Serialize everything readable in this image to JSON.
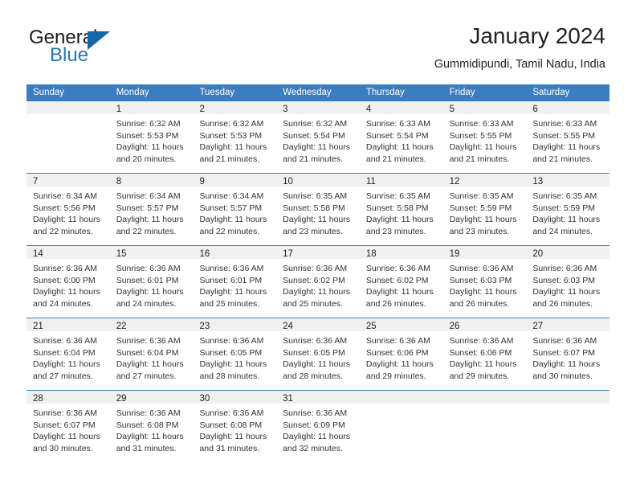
{
  "brand": {
    "name_line1": "General",
    "name_line2": "Blue",
    "triangle_color": "#1266ab",
    "blue_color": "#2376bc"
  },
  "header": {
    "title": "January 2024",
    "subtitle": "Gummidipundi, Tamil Nadu, India"
  },
  "theme": {
    "header_blue": "#3a7dc0",
    "daynum_band": "#f0f0f0",
    "text": "#222222"
  },
  "calendar": {
    "weekday_headers": [
      "Sunday",
      "Monday",
      "Tuesday",
      "Wednesday",
      "Thursday",
      "Friday",
      "Saturday"
    ],
    "weeks": [
      [
        {
          "day": "",
          "empty": true,
          "sunrise": "",
          "sunset": "",
          "daylight_l1": "",
          "daylight_l2": ""
        },
        {
          "day": "1",
          "empty": false,
          "sunrise": "Sunrise: 6:32 AM",
          "sunset": "Sunset: 5:53 PM",
          "daylight_l1": "Daylight: 11 hours",
          "daylight_l2": "and 20 minutes."
        },
        {
          "day": "2",
          "empty": false,
          "sunrise": "Sunrise: 6:32 AM",
          "sunset": "Sunset: 5:53 PM",
          "daylight_l1": "Daylight: 11 hours",
          "daylight_l2": "and 21 minutes."
        },
        {
          "day": "3",
          "empty": false,
          "sunrise": "Sunrise: 6:32 AM",
          "sunset": "Sunset: 5:54 PM",
          "daylight_l1": "Daylight: 11 hours",
          "daylight_l2": "and 21 minutes."
        },
        {
          "day": "4",
          "empty": false,
          "sunrise": "Sunrise: 6:33 AM",
          "sunset": "Sunset: 5:54 PM",
          "daylight_l1": "Daylight: 11 hours",
          "daylight_l2": "and 21 minutes."
        },
        {
          "day": "5",
          "empty": false,
          "sunrise": "Sunrise: 6:33 AM",
          "sunset": "Sunset: 5:55 PM",
          "daylight_l1": "Daylight: 11 hours",
          "daylight_l2": "and 21 minutes."
        },
        {
          "day": "6",
          "empty": false,
          "sunrise": "Sunrise: 6:33 AM",
          "sunset": "Sunset: 5:55 PM",
          "daylight_l1": "Daylight: 11 hours",
          "daylight_l2": "and 21 minutes."
        }
      ],
      [
        {
          "day": "7",
          "empty": false,
          "sunrise": "Sunrise: 6:34 AM",
          "sunset": "Sunset: 5:56 PM",
          "daylight_l1": "Daylight: 11 hours",
          "daylight_l2": "and 22 minutes."
        },
        {
          "day": "8",
          "empty": false,
          "sunrise": "Sunrise: 6:34 AM",
          "sunset": "Sunset: 5:57 PM",
          "daylight_l1": "Daylight: 11 hours",
          "daylight_l2": "and 22 minutes."
        },
        {
          "day": "9",
          "empty": false,
          "sunrise": "Sunrise: 6:34 AM",
          "sunset": "Sunset: 5:57 PM",
          "daylight_l1": "Daylight: 11 hours",
          "daylight_l2": "and 22 minutes."
        },
        {
          "day": "10",
          "empty": false,
          "sunrise": "Sunrise: 6:35 AM",
          "sunset": "Sunset: 5:58 PM",
          "daylight_l1": "Daylight: 11 hours",
          "daylight_l2": "and 23 minutes."
        },
        {
          "day": "11",
          "empty": false,
          "sunrise": "Sunrise: 6:35 AM",
          "sunset": "Sunset: 5:58 PM",
          "daylight_l1": "Daylight: 11 hours",
          "daylight_l2": "and 23 minutes."
        },
        {
          "day": "12",
          "empty": false,
          "sunrise": "Sunrise: 6:35 AM",
          "sunset": "Sunset: 5:59 PM",
          "daylight_l1": "Daylight: 11 hours",
          "daylight_l2": "and 23 minutes."
        },
        {
          "day": "13",
          "empty": false,
          "sunrise": "Sunrise: 6:35 AM",
          "sunset": "Sunset: 5:59 PM",
          "daylight_l1": "Daylight: 11 hours",
          "daylight_l2": "and 24 minutes."
        }
      ],
      [
        {
          "day": "14",
          "empty": false,
          "sunrise": "Sunrise: 6:36 AM",
          "sunset": "Sunset: 6:00 PM",
          "daylight_l1": "Daylight: 11 hours",
          "daylight_l2": "and 24 minutes."
        },
        {
          "day": "15",
          "empty": false,
          "sunrise": "Sunrise: 6:36 AM",
          "sunset": "Sunset: 6:01 PM",
          "daylight_l1": "Daylight: 11 hours",
          "daylight_l2": "and 24 minutes."
        },
        {
          "day": "16",
          "empty": false,
          "sunrise": "Sunrise: 6:36 AM",
          "sunset": "Sunset: 6:01 PM",
          "daylight_l1": "Daylight: 11 hours",
          "daylight_l2": "and 25 minutes."
        },
        {
          "day": "17",
          "empty": false,
          "sunrise": "Sunrise: 6:36 AM",
          "sunset": "Sunset: 6:02 PM",
          "daylight_l1": "Daylight: 11 hours",
          "daylight_l2": "and 25 minutes."
        },
        {
          "day": "18",
          "empty": false,
          "sunrise": "Sunrise: 6:36 AM",
          "sunset": "Sunset: 6:02 PM",
          "daylight_l1": "Daylight: 11 hours",
          "daylight_l2": "and 26 minutes."
        },
        {
          "day": "19",
          "empty": false,
          "sunrise": "Sunrise: 6:36 AM",
          "sunset": "Sunset: 6:03 PM",
          "daylight_l1": "Daylight: 11 hours",
          "daylight_l2": "and 26 minutes."
        },
        {
          "day": "20",
          "empty": false,
          "sunrise": "Sunrise: 6:36 AM",
          "sunset": "Sunset: 6:03 PM",
          "daylight_l1": "Daylight: 11 hours",
          "daylight_l2": "and 26 minutes."
        }
      ],
      [
        {
          "day": "21",
          "empty": false,
          "sunrise": "Sunrise: 6:36 AM",
          "sunset": "Sunset: 6:04 PM",
          "daylight_l1": "Daylight: 11 hours",
          "daylight_l2": "and 27 minutes."
        },
        {
          "day": "22",
          "empty": false,
          "sunrise": "Sunrise: 6:36 AM",
          "sunset": "Sunset: 6:04 PM",
          "daylight_l1": "Daylight: 11 hours",
          "daylight_l2": "and 27 minutes."
        },
        {
          "day": "23",
          "empty": false,
          "sunrise": "Sunrise: 6:36 AM",
          "sunset": "Sunset: 6:05 PM",
          "daylight_l1": "Daylight: 11 hours",
          "daylight_l2": "and 28 minutes."
        },
        {
          "day": "24",
          "empty": false,
          "sunrise": "Sunrise: 6:36 AM",
          "sunset": "Sunset: 6:05 PM",
          "daylight_l1": "Daylight: 11 hours",
          "daylight_l2": "and 28 minutes."
        },
        {
          "day": "25",
          "empty": false,
          "sunrise": "Sunrise: 6:36 AM",
          "sunset": "Sunset: 6:06 PM",
          "daylight_l1": "Daylight: 11 hours",
          "daylight_l2": "and 29 minutes."
        },
        {
          "day": "26",
          "empty": false,
          "sunrise": "Sunrise: 6:36 AM",
          "sunset": "Sunset: 6:06 PM",
          "daylight_l1": "Daylight: 11 hours",
          "daylight_l2": "and 29 minutes."
        },
        {
          "day": "27",
          "empty": false,
          "sunrise": "Sunrise: 6:36 AM",
          "sunset": "Sunset: 6:07 PM",
          "daylight_l1": "Daylight: 11 hours",
          "daylight_l2": "and 30 minutes."
        }
      ],
      [
        {
          "day": "28",
          "empty": false,
          "sunrise": "Sunrise: 6:36 AM",
          "sunset": "Sunset: 6:07 PM",
          "daylight_l1": "Daylight: 11 hours",
          "daylight_l2": "and 30 minutes."
        },
        {
          "day": "29",
          "empty": false,
          "sunrise": "Sunrise: 6:36 AM",
          "sunset": "Sunset: 6:08 PM",
          "daylight_l1": "Daylight: 11 hours",
          "daylight_l2": "and 31 minutes."
        },
        {
          "day": "30",
          "empty": false,
          "sunrise": "Sunrise: 6:36 AM",
          "sunset": "Sunset: 6:08 PM",
          "daylight_l1": "Daylight: 11 hours",
          "daylight_l2": "and 31 minutes."
        },
        {
          "day": "31",
          "empty": false,
          "sunrise": "Sunrise: 6:36 AM",
          "sunset": "Sunset: 6:09 PM",
          "daylight_l1": "Daylight: 11 hours",
          "daylight_l2": "and 32 minutes."
        },
        {
          "day": "",
          "empty": true,
          "sunrise": "",
          "sunset": "",
          "daylight_l1": "",
          "daylight_l2": ""
        },
        {
          "day": "",
          "empty": true,
          "sunrise": "",
          "sunset": "",
          "daylight_l1": "",
          "daylight_l2": ""
        },
        {
          "day": "",
          "empty": true,
          "sunrise": "",
          "sunset": "",
          "daylight_l1": "",
          "daylight_l2": ""
        }
      ]
    ]
  }
}
